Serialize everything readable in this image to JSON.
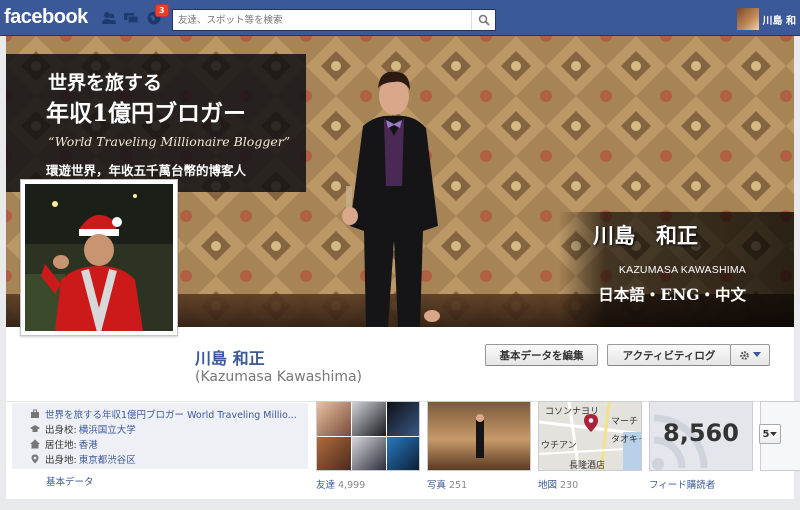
{
  "topbar": {
    "logo": "facebook",
    "notification_count": "3",
    "search_placeholder": "友達、スポット等を検索",
    "user_name": "川島 和"
  },
  "cover": {
    "line1": "世界を旅する",
    "line2": "年収1億円ブロガー",
    "line3": "“World Traveling Millionaire Blogger”",
    "line4": "環遊世界，年收五千萬台幣的博客人",
    "name_jp": "川島　和正",
    "name_en": "KAZUMASA KAWASHIMA",
    "languages": "日本語・ENG・中文"
  },
  "profile": {
    "name": "川島 和正",
    "alt_name": "(Kazumasa Kawashima)",
    "edit_button": "基本データを編集",
    "activity_button": "アクティビティログ"
  },
  "info": {
    "work": "世界を旅する年収1億円ブロガー World Traveling Millio...",
    "school_label": "出身校:",
    "school": "横浜国立大学",
    "lives_label": "居住地:",
    "lives": "香港",
    "from_label": "出身地:",
    "from": "東京都渋谷区",
    "more": "基本データ"
  },
  "apps": {
    "friends_label": "友達",
    "friends_count": "4,999",
    "photos_label": "写真",
    "photos_count": "251",
    "map_label": "地図",
    "map_count": "230",
    "map_text": {
      "a": "コソンナヨリ",
      "b": "マーチ",
      "c": "ウチアン",
      "d": "タオキャ",
      "e": "長隆酒店"
    },
    "subscribers_value": "8,560",
    "subscribers_label": "フィード購読者",
    "more_count": "5"
  },
  "colors": {
    "fb_blue": "#3b5998",
    "page_bg": "#e9eaed",
    "notification": "#f03d25"
  },
  "icons": [
    "friend-requests-icon",
    "messages-icon",
    "notifications-globe-icon",
    "search-icon",
    "gear-icon",
    "chevron-down-icon",
    "work-icon",
    "school-icon",
    "home-icon",
    "location-pin-icon",
    "rss-icon"
  ]
}
